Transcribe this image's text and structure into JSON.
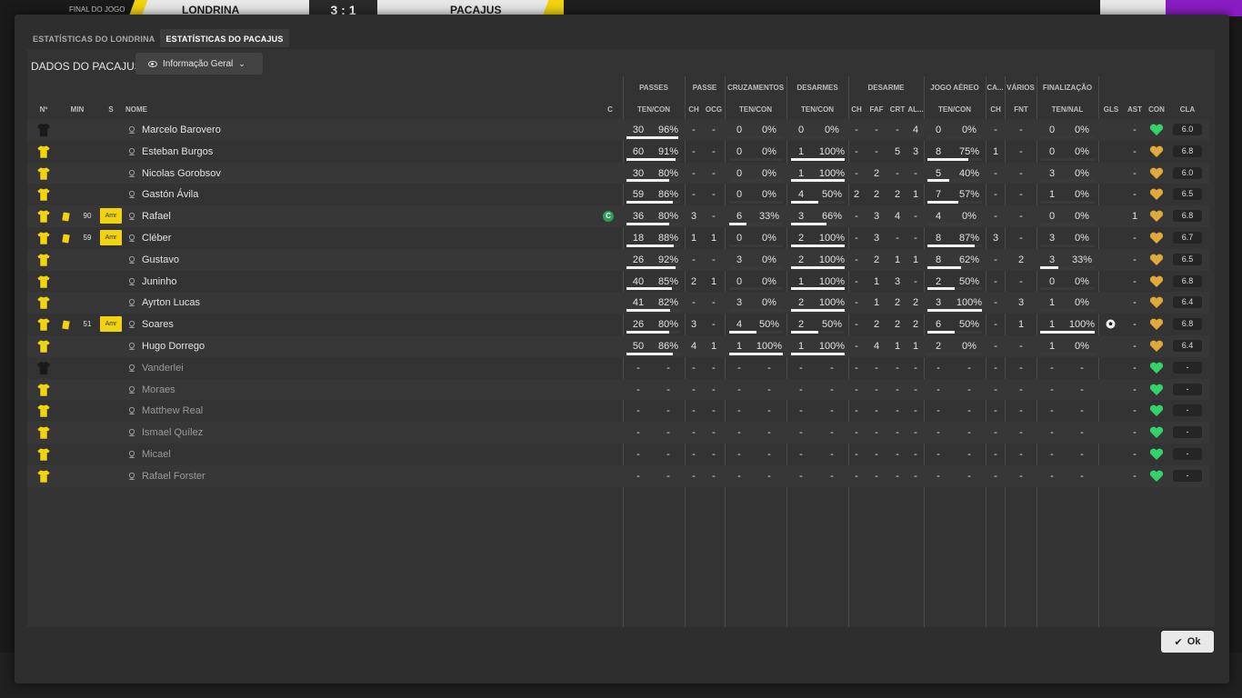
{
  "topbar": {
    "status": "FINAL DO JOGO",
    "home": "LONDRINA",
    "score": "3 : 1",
    "away": "PACAJUS"
  },
  "tabs": [
    "ESTATÍSTICAS DO LONDRINA",
    "ESTATÍSTICAS DO PACAJUS"
  ],
  "panel": {
    "title": "DADOS DO PACAJUS",
    "view": "Informação Geral"
  },
  "group_headers": [
    "PASSES",
    "PASSE",
    "CRUZAMENTOS",
    "DESARMES",
    "DESARME",
    "JOGO AÉREO",
    "CA...",
    "VÁRIOS",
    "FINALIZAÇÃO"
  ],
  "col_headers": {
    "num": "Nº",
    "min": "MIN",
    "s": "S",
    "name": "NOME",
    "c": "C",
    "passes": "TEN/CON",
    "ch1": "CH",
    "ocg": "OCG",
    "cross": "TEN/CON",
    "tackles": "TEN/CON",
    "ch2": "CH",
    "faf": "FAF",
    "crt": "CRT",
    "al": "AL...",
    "aerial": "TEN/CON",
    "ch3": "CH",
    "fnt": "FNT",
    "shots": "TEN/NAL",
    "gls": "GLS",
    "ast": "AST",
    "con": "CON",
    "cla": "CLA"
  },
  "colors": {
    "yellow": "#f2d311",
    "green_heart": "#32d46a",
    "orange_heart": "#e0a93a",
    "gk_shirt": "#1a1a1a"
  },
  "ok_label": "Ok",
  "rows": [
    {
      "name": "Marcelo Barovero",
      "shirt": "gk",
      "min": "",
      "card": false,
      "s": "",
      "cap": false,
      "pa": "30",
      "pp": "96%",
      "pf": 0.96,
      "ch": "-",
      "ocg": "-",
      "cr": "0",
      "crp": "0%",
      "crf": 0,
      "ta": "0",
      "tp": "0%",
      "tf": 0,
      "ch2": "-",
      "faf": "-",
      "crt": "-",
      "al": "4",
      "ae": "0",
      "aep": "0%",
      "aef": 0,
      "ch3": "-",
      "fnt": "-",
      "sh": "0",
      "shp": "0%",
      "shf": 0,
      "gls": "",
      "ast": "-",
      "con": "green",
      "cla": "6.0",
      "ball": false
    },
    {
      "name": "Esteban Burgos",
      "shirt": "y",
      "min": "",
      "card": false,
      "s": "",
      "cap": false,
      "pa": "60",
      "pp": "91%",
      "pf": 0.91,
      "ch": "-",
      "ocg": "-",
      "cr": "0",
      "crp": "0%",
      "crf": 0,
      "ta": "1",
      "tp": "100%",
      "tf": 1,
      "ch2": "-",
      "faf": "-",
      "crt": "5",
      "al": "3",
      "ae": "8",
      "aep": "75%",
      "aef": 0.75,
      "ch3": "1",
      "fnt": "-",
      "sh": "0",
      "shp": "0%",
      "shf": 0,
      "gls": "",
      "ast": "-",
      "con": "orange",
      "cla": "6.8",
      "ball": false
    },
    {
      "name": "Nicolas Gorobsov",
      "shirt": "y",
      "min": "",
      "card": false,
      "s": "",
      "cap": false,
      "pa": "30",
      "pp": "80%",
      "pf": 0.8,
      "ch": "-",
      "ocg": "-",
      "cr": "0",
      "crp": "0%",
      "crf": 0,
      "ta": "1",
      "tp": "100%",
      "tf": 1,
      "ch2": "-",
      "faf": "2",
      "crt": "-",
      "al": "-",
      "ae": "5",
      "aep": "40%",
      "aef": 0.4,
      "ch3": "-",
      "fnt": "-",
      "sh": "3",
      "shp": "0%",
      "shf": 0,
      "gls": "",
      "ast": "-",
      "con": "orange",
      "cla": "6.0",
      "ball": false
    },
    {
      "name": "Gastón Ávila",
      "shirt": "y",
      "min": "",
      "card": false,
      "s": "",
      "cap": false,
      "pa": "59",
      "pp": "86%",
      "pf": 0.86,
      "ch": "-",
      "ocg": "-",
      "cr": "0",
      "crp": "0%",
      "crf": 0,
      "ta": "4",
      "tp": "50%",
      "tf": 0.5,
      "ch2": "2",
      "faf": "2",
      "crt": "2",
      "al": "1",
      "ae": "7",
      "aep": "57%",
      "aef": 0.57,
      "ch3": "-",
      "fnt": "-",
      "sh": "1",
      "shp": "0%",
      "shf": 0,
      "gls": "",
      "ast": "-",
      "con": "orange",
      "cla": "6.5",
      "ball": false
    },
    {
      "name": "Rafael",
      "shirt": "y",
      "min": "90",
      "card": true,
      "s": "Amr",
      "cap": true,
      "pa": "36",
      "pp": "80%",
      "pf": 0.8,
      "ch": "3",
      "ocg": "-",
      "cr": "6",
      "crp": "33%",
      "crf": 0.33,
      "ta": "3",
      "tp": "66%",
      "tf": 0.66,
      "ch2": "-",
      "faf": "3",
      "crt": "4",
      "al": "-",
      "ae": "4",
      "aep": "0%",
      "aef": 0,
      "ch3": "-",
      "fnt": "-",
      "sh": "0",
      "shp": "0%",
      "shf": 0,
      "gls": "",
      "ast": "1",
      "con": "orange",
      "cla": "6.8",
      "ball": false
    },
    {
      "name": "Cléber",
      "shirt": "y",
      "min": "59",
      "card": true,
      "s": "Amr",
      "cap": false,
      "pa": "18",
      "pp": "88%",
      "pf": 0.88,
      "ch": "1",
      "ocg": "1",
      "cr": "0",
      "crp": "0%",
      "crf": 0,
      "ta": "2",
      "tp": "100%",
      "tf": 1,
      "ch2": "-",
      "faf": "3",
      "crt": "-",
      "al": "-",
      "ae": "8",
      "aep": "87%",
      "aef": 0.87,
      "ch3": "3",
      "fnt": "-",
      "sh": "3",
      "shp": "0%",
      "shf": 0,
      "gls": "",
      "ast": "-",
      "con": "orange",
      "cla": "6.7",
      "ball": false
    },
    {
      "name": "Gustavo",
      "shirt": "y",
      "min": "",
      "card": false,
      "s": "",
      "cap": false,
      "pa": "26",
      "pp": "92%",
      "pf": 0.92,
      "ch": "-",
      "ocg": "-",
      "cr": "3",
      "crp": "0%",
      "crf": 0,
      "ta": "2",
      "tp": "100%",
      "tf": 1,
      "ch2": "-",
      "faf": "2",
      "crt": "1",
      "al": "1",
      "ae": "8",
      "aep": "62%",
      "aef": 0.62,
      "ch3": "-",
      "fnt": "2",
      "sh": "3",
      "shp": "33%",
      "shf": 0.33,
      "gls": "",
      "ast": "-",
      "con": "orange",
      "cla": "6.5",
      "ball": false
    },
    {
      "name": "Juninho",
      "shirt": "y",
      "min": "",
      "card": false,
      "s": "",
      "cap": false,
      "pa": "40",
      "pp": "85%",
      "pf": 0.85,
      "ch": "2",
      "ocg": "1",
      "cr": "0",
      "crp": "0%",
      "crf": 0,
      "ta": "1",
      "tp": "100%",
      "tf": 1,
      "ch2": "-",
      "faf": "1",
      "crt": "3",
      "al": "-",
      "ae": "2",
      "aep": "50%",
      "aef": 0.5,
      "ch3": "-",
      "fnt": "-",
      "sh": "0",
      "shp": "0%",
      "shf": 0,
      "gls": "",
      "ast": "-",
      "con": "orange",
      "cla": "6.8",
      "ball": false
    },
    {
      "name": "Ayrton Lucas",
      "shirt": "y",
      "min": "",
      "card": false,
      "s": "",
      "cap": false,
      "pa": "41",
      "pp": "82%",
      "pf": 0.82,
      "ch": "-",
      "ocg": "-",
      "cr": "3",
      "crp": "0%",
      "crf": 0,
      "ta": "2",
      "tp": "100%",
      "tf": 1,
      "ch2": "-",
      "faf": "1",
      "crt": "2",
      "al": "2",
      "ae": "3",
      "aep": "100%",
      "aef": 1,
      "ch3": "-",
      "fnt": "3",
      "sh": "1",
      "shp": "0%",
      "shf": 0,
      "gls": "",
      "ast": "-",
      "con": "orange",
      "cla": "6.4",
      "ball": false
    },
    {
      "name": "Soares",
      "shirt": "y",
      "min": "51",
      "card": true,
      "s": "Amr",
      "cap": false,
      "pa": "26",
      "pp": "80%",
      "pf": 0.8,
      "ch": "3",
      "ocg": "-",
      "cr": "4",
      "crp": "50%",
      "crf": 0.5,
      "ta": "2",
      "tp": "50%",
      "tf": 0.5,
      "ch2": "-",
      "faf": "2",
      "crt": "2",
      "al": "2",
      "ae": "6",
      "aep": "50%",
      "aef": 0.5,
      "ch3": "-",
      "fnt": "1",
      "sh": "1",
      "shp": "100%",
      "shf": 1,
      "gls": "",
      "ast": "-",
      "con": "orange",
      "cla": "6.8",
      "ball": true
    },
    {
      "name": "Hugo Dorrego",
      "shirt": "y",
      "min": "",
      "card": false,
      "s": "",
      "cap": false,
      "pa": "50",
      "pp": "86%",
      "pf": 0.86,
      "ch": "4",
      "ocg": "1",
      "cr": "1",
      "crp": "100%",
      "crf": 1,
      "ta": "1",
      "tp": "100%",
      "tf": 1,
      "ch2": "-",
      "faf": "4",
      "crt": "1",
      "al": "1",
      "ae": "2",
      "aep": "0%",
      "aef": 0,
      "ch3": "-",
      "fnt": "-",
      "sh": "1",
      "shp": "0%",
      "shf": 0,
      "gls": "",
      "ast": "-",
      "con": "orange",
      "cla": "6.4",
      "ball": false
    },
    {
      "name": "Vanderlei",
      "shirt": "gk",
      "sub": true
    },
    {
      "name": "Moraes",
      "shirt": "y",
      "sub": true
    },
    {
      "name": "Matthew Real",
      "shirt": "y",
      "sub": true
    },
    {
      "name": "Ismael Quílez",
      "shirt": "y",
      "sub": true
    },
    {
      "name": "Micael",
      "shirt": "y",
      "sub": true
    },
    {
      "name": "Rafael Forster",
      "shirt": "y",
      "sub": true
    }
  ]
}
